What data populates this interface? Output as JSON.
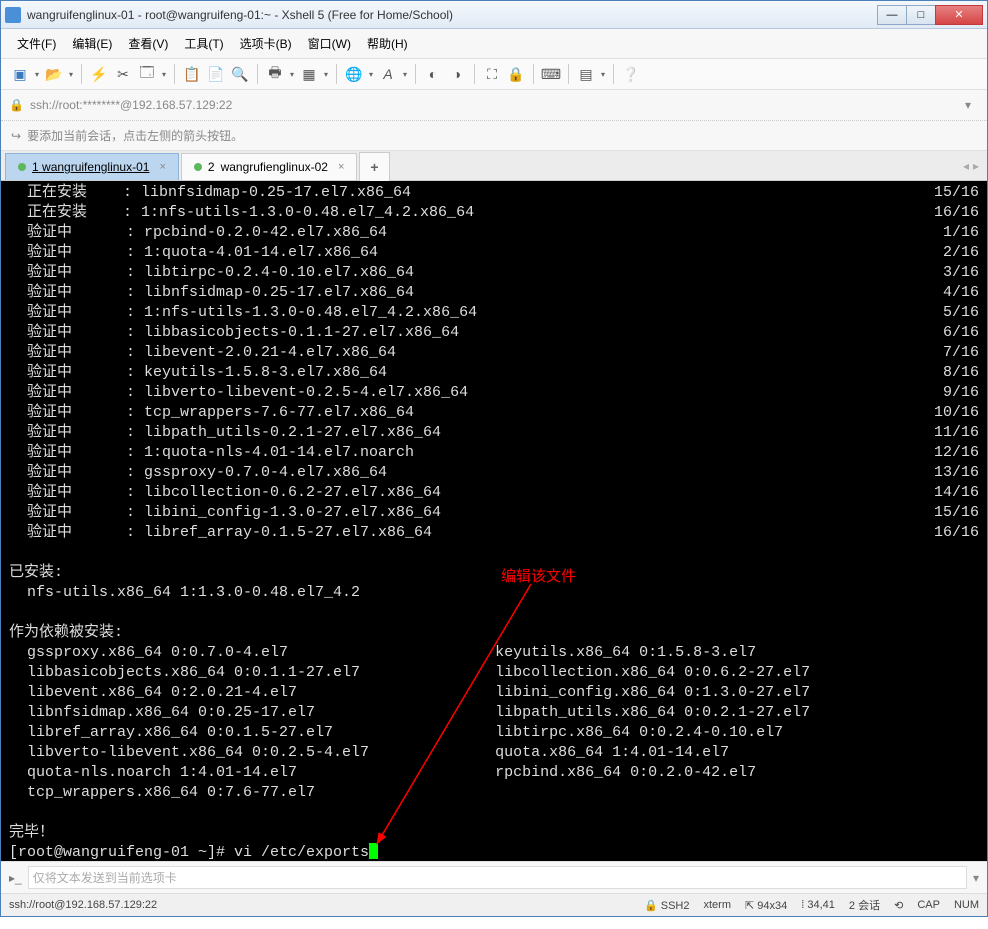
{
  "titlebar": {
    "text": "wangruifenglinux-01 - root@wangruifeng-01:~ - Xshell 5 (Free for Home/School)"
  },
  "menu": {
    "file": "文件(F)",
    "edit": "编辑(E)",
    "view": "查看(V)",
    "tools": "工具(T)",
    "tab": "选项卡(B)",
    "window": "窗口(W)",
    "help": "帮助(H)"
  },
  "addressbar": {
    "text": "ssh://root:********@192.168.57.129:22"
  },
  "hint": "要添加当前会话，点击左侧的箭头按钮。",
  "tabs": {
    "t1": {
      "num": "1",
      "label": "wangruifenglinux-01"
    },
    "t2": {
      "num": "2",
      "label": "wangrufienglinux-02"
    }
  },
  "terminal": {
    "lines": [
      {
        "l": "  正在安装    : libnfsidmap-0.25-17.el7.x86_64",
        "r": "15/16"
      },
      {
        "l": "  正在安装    : 1:nfs-utils-1.3.0-0.48.el7_4.2.x86_64",
        "r": "16/16"
      },
      {
        "l": "  验证中      : rpcbind-0.2.0-42.el7.x86_64",
        "r": "1/16"
      },
      {
        "l": "  验证中      : 1:quota-4.01-14.el7.x86_64",
        "r": "2/16"
      },
      {
        "l": "  验证中      : libtirpc-0.2.4-0.10.el7.x86_64",
        "r": "3/16"
      },
      {
        "l": "  验证中      : libnfsidmap-0.25-17.el7.x86_64",
        "r": "4/16"
      },
      {
        "l": "  验证中      : 1:nfs-utils-1.3.0-0.48.el7_4.2.x86_64",
        "r": "5/16"
      },
      {
        "l": "  验证中      : libbasicobjects-0.1.1-27.el7.x86_64",
        "r": "6/16"
      },
      {
        "l": "  验证中      : libevent-2.0.21-4.el7.x86_64",
        "r": "7/16"
      },
      {
        "l": "  验证中      : keyutils-1.5.8-3.el7.x86_64",
        "r": "8/16"
      },
      {
        "l": "  验证中      : libverto-libevent-0.2.5-4.el7.x86_64",
        "r": "9/16"
      },
      {
        "l": "  验证中      : tcp_wrappers-7.6-77.el7.x86_64",
        "r": "10/16"
      },
      {
        "l": "  验证中      : libpath_utils-0.2.1-27.el7.x86_64",
        "r": "11/16"
      },
      {
        "l": "  验证中      : 1:quota-nls-4.01-14.el7.noarch",
        "r": "12/16"
      },
      {
        "l": "  验证中      : gssproxy-0.7.0-4.el7.x86_64",
        "r": "13/16"
      },
      {
        "l": "  验证中      : libcollection-0.6.2-27.el7.x86_64",
        "r": "14/16"
      },
      {
        "l": "  验证中      : libini_config-1.3.0-27.el7.x86_64",
        "r": "15/16"
      },
      {
        "l": "  验证中      : libref_array-0.1.5-27.el7.x86_64",
        "r": "16/16"
      }
    ],
    "installed_header": "已安装:",
    "installed_pkg": "  nfs-utils.x86_64 1:1.3.0-0.48.el7_4.2",
    "deps_header": "作为依赖被安装:",
    "dep_pairs": [
      {
        "l": "  gssproxy.x86_64 0:0.7.0-4.el7",
        "r": "keyutils.x86_64 0:1.5.8-3.el7"
      },
      {
        "l": "  libbasicobjects.x86_64 0:0.1.1-27.el7",
        "r": "libcollection.x86_64 0:0.6.2-27.el7"
      },
      {
        "l": "  libevent.x86_64 0:2.0.21-4.el7",
        "r": "libini_config.x86_64 0:1.3.0-27.el7"
      },
      {
        "l": "  libnfsidmap.x86_64 0:0.25-17.el7",
        "r": "libpath_utils.x86_64 0:0.2.1-27.el7"
      },
      {
        "l": "  libref_array.x86_64 0:0.1.5-27.el7",
        "r": "libtirpc.x86_64 0:0.2.4-0.10.el7"
      },
      {
        "l": "  libverto-libevent.x86_64 0:0.2.5-4.el7",
        "r": "quota.x86_64 1:4.01-14.el7"
      },
      {
        "l": "  quota-nls.noarch 1:4.01-14.el7",
        "r": "rpcbind.x86_64 0:0.2.0-42.el7"
      },
      {
        "l": "  tcp_wrappers.x86_64 0:7.6-77.el7",
        "r": ""
      }
    ],
    "complete": "完毕！",
    "prompt": "[root@wangruifeng-01 ~]# vi /etc/exports"
  },
  "annotation": {
    "text": "编辑该文件"
  },
  "sendbar": {
    "placeholder": "仅将文本发送到当前选项卡"
  },
  "statusbar": {
    "conn": "ssh://root@192.168.57.129:22",
    "proto": "SSH2",
    "term": "xterm",
    "size": "94x34",
    "pos": "34,41",
    "sessions": "2 会话",
    "cap": "CAP",
    "num": "NUM"
  }
}
